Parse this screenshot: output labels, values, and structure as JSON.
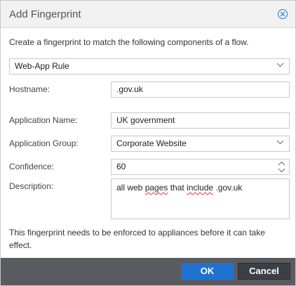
{
  "dialog": {
    "title": "Add Fingerprint",
    "intro": "Create a fingerprint to match the following components of a flow.",
    "rule_type": "Web-App Rule",
    "fields": {
      "hostname": {
        "label": "Hostname:",
        "value": ".gov.uk"
      },
      "app_name": {
        "label": "Application Name:",
        "value": "UK government"
      },
      "app_group": {
        "label": "Application Group:",
        "value": "Corporate Website"
      },
      "confidence": {
        "label": "Confidence:",
        "value": "60"
      },
      "description": {
        "label": "Description:",
        "value_before": "all web ",
        "value_misspelled": "pages",
        "value_middle": " that ",
        "value_misspelled2": "include",
        "value_after": " .gov.uk"
      }
    },
    "note": "This fingerprint needs to be enforced to appliances before it can take effect.",
    "buttons": {
      "ok": "OK",
      "cancel": "Cancel"
    }
  },
  "colors": {
    "primary": "#1f72d0",
    "footer": "#5a5b60",
    "close_icon": "#2b78c6"
  }
}
